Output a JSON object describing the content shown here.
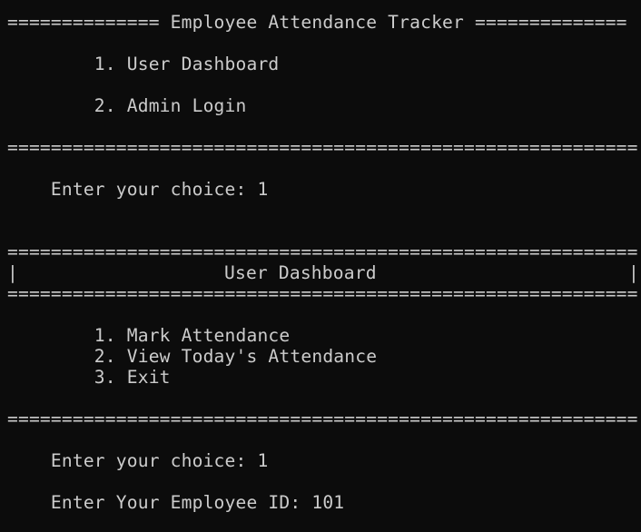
{
  "terminal": {
    "header_line": "============== Employee Attendance Tracker ==============",
    "main_menu": [
      "        1. User Dashboard",
      "        2. Admin Login"
    ],
    "separator": "==========================================================",
    "prompt_1": "    Enter your choice: 1",
    "dashboard_box": {
      "left_bar": "|",
      "title": "User Dashboard",
      "right_bar": "|"
    },
    "dashboard_menu": [
      "        1. Mark Attendance",
      "        2. View Today's Attendance",
      "        3. Exit"
    ],
    "prompt_2": "    Enter your choice: 1",
    "prompt_3": "    Enter Your Employee ID: 101"
  }
}
